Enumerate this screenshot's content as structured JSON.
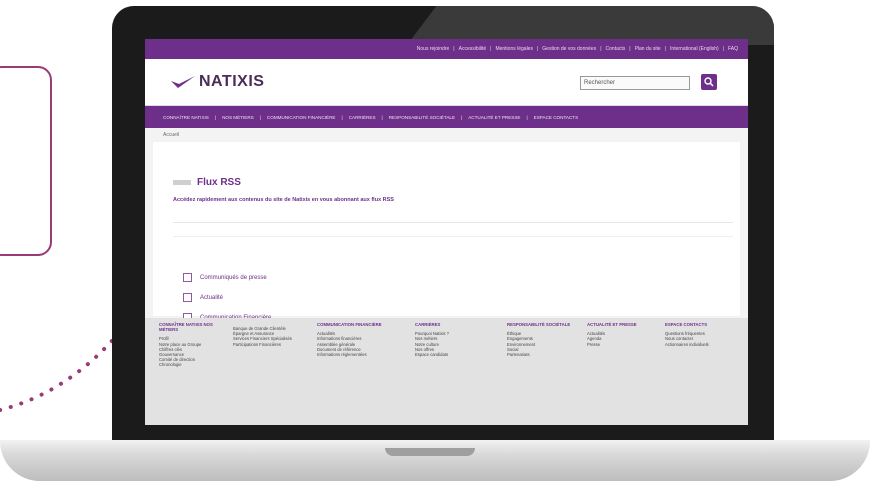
{
  "topbar": {
    "links": [
      "Nous rejoindre",
      "Accessibilité",
      "Mentions légales",
      "Gestion de vos données",
      "Contacts",
      "Plan du site",
      "International (English)",
      "FAQ"
    ]
  },
  "header": {
    "logo_text": "NATIXIS",
    "search_placeholder": "Rechercher"
  },
  "mainnav": {
    "items": [
      "CONNAÎTRE NATIXIS",
      "NOS MÉTIERS",
      "COMMUNICATION FINANCIÈRE",
      "CARRIÈRES",
      "RESPONSABILITÉ SOCIÉTALE",
      "ACTUALITÉ ET PRESSE",
      "ESPACE CONTACTS"
    ]
  },
  "breadcrumb": "Accueil",
  "page": {
    "title": "Flux RSS",
    "intro": "Accédez rapidement aux contenus du site de Natixis en vous abonnant aux flux RSS",
    "rss_items": [
      "Communiqués de presse",
      "Actualité",
      "Communication Financière"
    ]
  },
  "footer": {
    "columns": [
      {
        "title": "CONNAÎTRE NATIXIS NOS MÉTIERS",
        "links": [
          "Profil",
          "Notre place au Groupe",
          "Chiffres clés",
          "Gouvernance",
          "Comité de direction",
          "Chronologie"
        ]
      },
      {
        "title": "",
        "links": [
          "Banque de Grande Clientèle",
          "Épargne et Assurance",
          "Services Financiers Spécialisés",
          "Participations Financières"
        ]
      },
      {
        "title": "COMMUNICATION FINANCIÈRE",
        "links": [
          "Actualités",
          "Informations financières",
          "Assemblée générale",
          "Document de référence",
          "Informations réglementées"
        ]
      },
      {
        "title": "CARRIÈRES",
        "links": [
          "Pourquoi Natixis ?",
          "Nos métiers",
          "Notre culture",
          "Nos offres",
          "Espace candidats"
        ]
      },
      {
        "title": "RESPONSABILITÉ SOCIÉTALE",
        "links": [
          "Éthique",
          "Engagements",
          "Environnement",
          "Social",
          "Partenariats"
        ]
      },
      {
        "title": "ACTUALITÉ ET PRESSE",
        "links": [
          "Actualités",
          "Agenda",
          "Presse"
        ]
      },
      {
        "title": "ESPACE CONTACTS",
        "links": [
          "Questions fréquentes",
          "Nous contacter",
          "Actionnaires individuels"
        ]
      }
    ]
  },
  "colors": {
    "brand": "#6d2f8a",
    "callout": "#9a3a78"
  }
}
